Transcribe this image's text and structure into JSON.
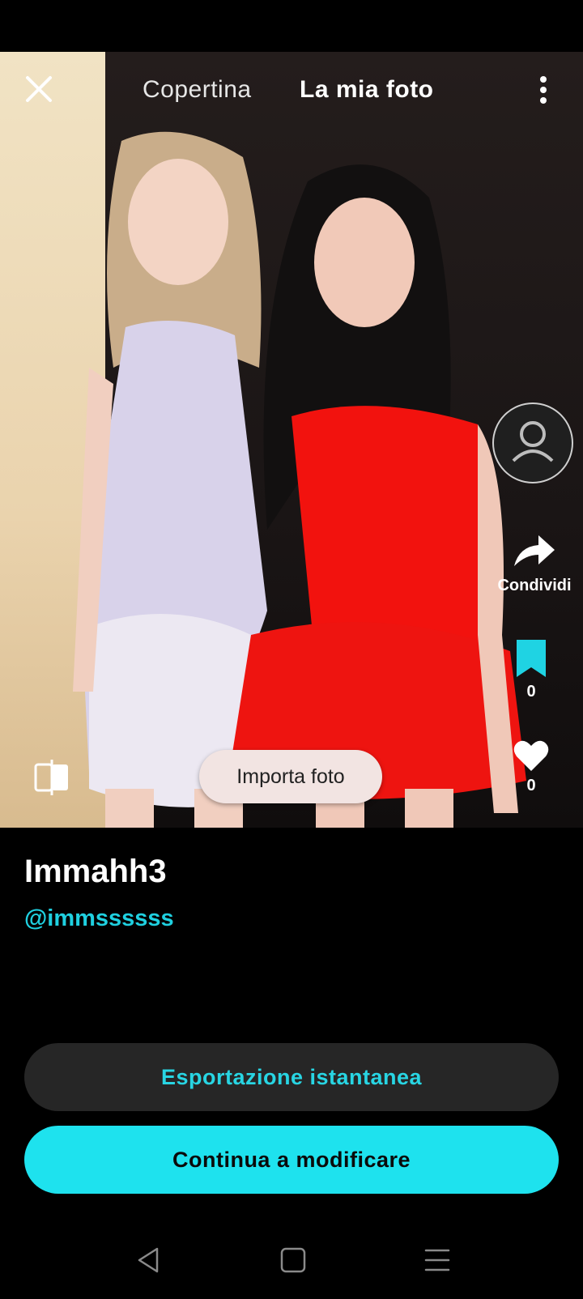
{
  "header": {
    "tabs": [
      {
        "label": "Copertina",
        "active": false
      },
      {
        "label": "La mia foto",
        "active": true
      }
    ],
    "close_icon": "close-icon",
    "more_icon": "more-vertical-icon"
  },
  "side_actions": {
    "share_label": "Condividi",
    "bookmark_count": "0",
    "like_count": "0"
  },
  "photo": {
    "import_label": "Importa foto"
  },
  "user": {
    "name": "Immahh3",
    "handle": "@immssssss"
  },
  "actions": {
    "export_label": "Esportazione istantanea",
    "continue_label": "Continua a modificare"
  },
  "colors": {
    "accent": "#1ee2ee",
    "accent_text": "#28d5e3",
    "dark_button": "#262626"
  }
}
